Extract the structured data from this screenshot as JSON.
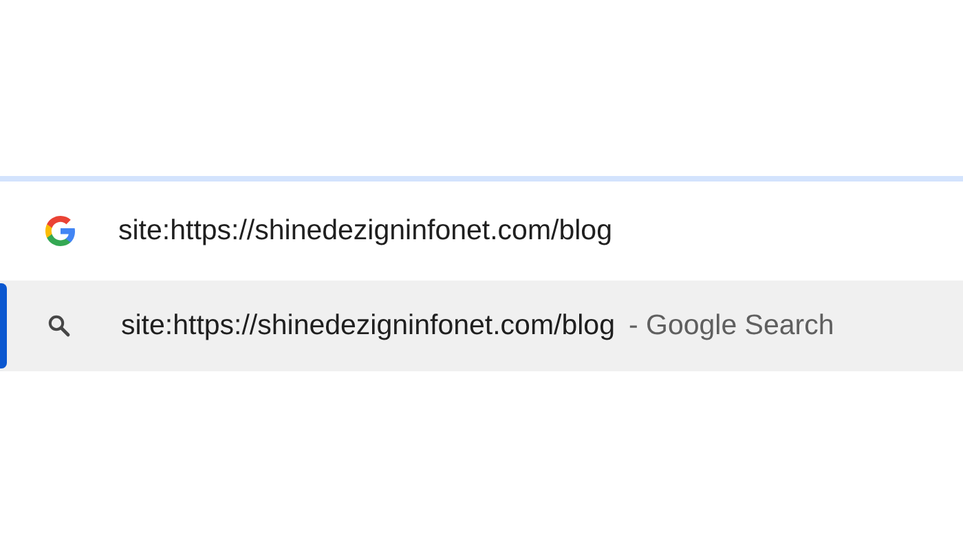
{
  "omnibox": {
    "text": "site:https://shinedezigninfonet.com/blog"
  },
  "suggestions": [
    {
      "kind": "search",
      "text": "site:https://shinedezigninfonet.com/blog",
      "suffix": "- Google Search",
      "selected": true
    }
  ]
}
